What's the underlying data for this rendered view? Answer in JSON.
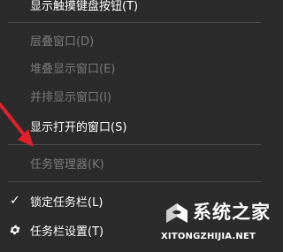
{
  "context_menu": {
    "items": [
      {
        "label": "显示触摸键盘按钮(T)",
        "enabled": true
      },
      {
        "label": "层叠窗口(D)",
        "enabled": false
      },
      {
        "label": "堆叠显示窗口(E)",
        "enabled": false
      },
      {
        "label": "并排显示窗口(I)",
        "enabled": false
      },
      {
        "label": "显示打开的窗口(S)",
        "enabled": true
      },
      {
        "label": "任务管理器(K)",
        "enabled": false
      },
      {
        "label": "锁定任务栏(L)",
        "enabled": true,
        "checked": true
      },
      {
        "label": "任务栏设置(T)",
        "enabled": true,
        "icon": "gear-icon"
      }
    ],
    "colors": {
      "background": "#2b2b2b",
      "text": "#ffffff",
      "disabled_text": "#7a7a7a",
      "separator": "#4d4d4d",
      "annotation_arrow": "#e0202a"
    }
  },
  "watermark": {
    "brand": "系统之家",
    "url": "XITONGZHIJIA.NET"
  }
}
